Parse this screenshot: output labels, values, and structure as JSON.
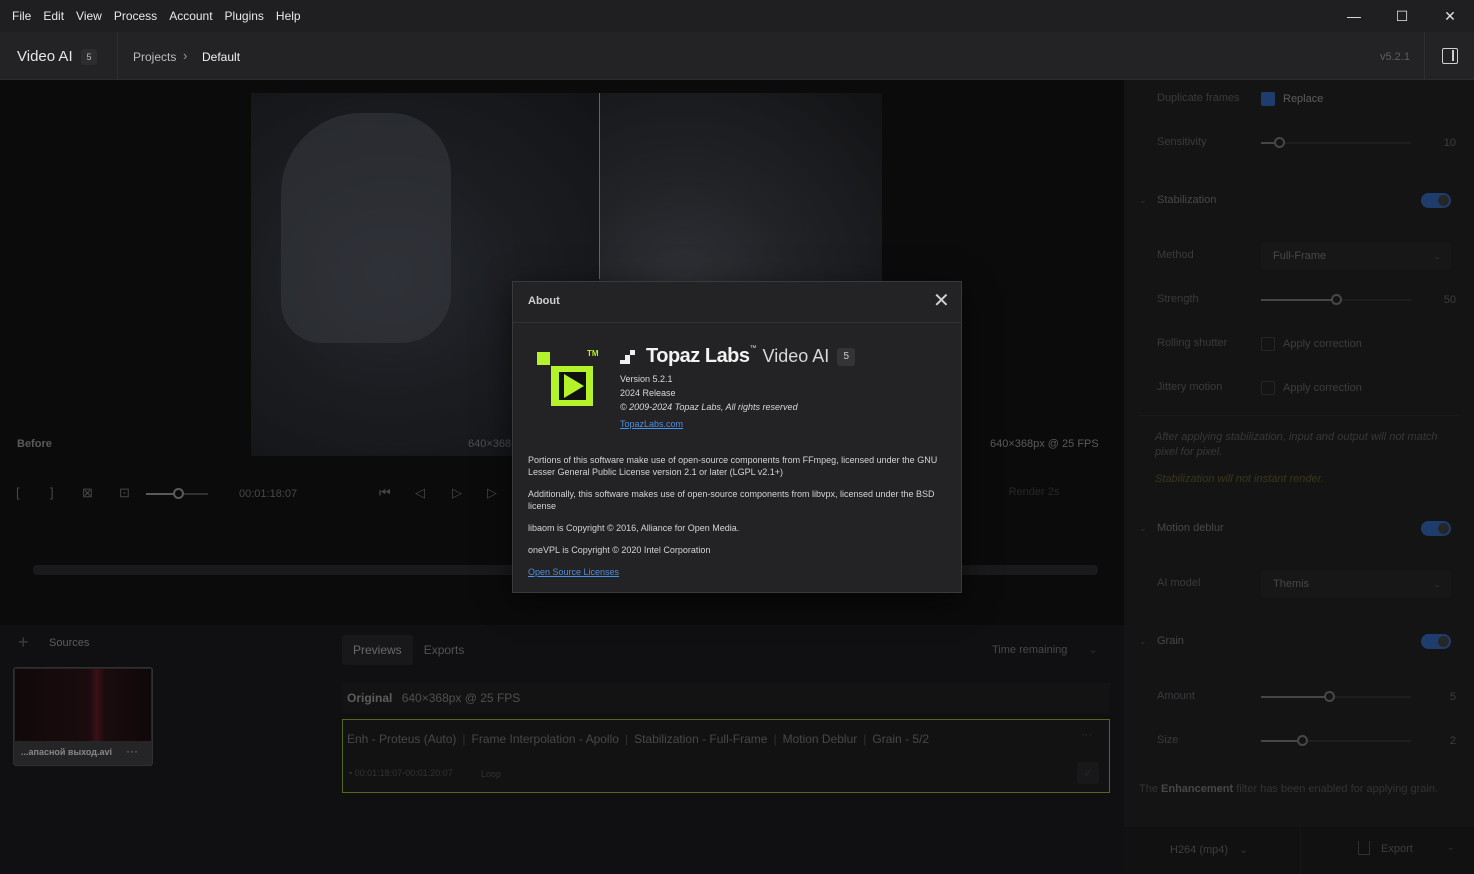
{
  "menu": [
    "File",
    "Edit",
    "View",
    "Process",
    "Account",
    "Plugins",
    "Help"
  ],
  "window_controls": {
    "minimize": "—",
    "maximize": "☐",
    "close": "✕"
  },
  "header": {
    "app_name": "Video AI",
    "app_badge": "5",
    "breadcrumb": [
      "Projects",
      "Default"
    ],
    "version": "v5.2.1"
  },
  "viewer": {
    "before_label": "Before",
    "resolution_left": "640×368",
    "resolution_right": "640×368px @ 25 FPS",
    "timecode": "00:01:18:07",
    "zoom_level": 0.5,
    "render_button": "Render 2s"
  },
  "sources": {
    "label": "Sources",
    "items": [
      {
        "name": "...апасной выход.avi"
      }
    ]
  },
  "queue": {
    "tabs": [
      "Previews",
      "Exports"
    ],
    "active_tab": "Previews",
    "sort_label": "Time remaining",
    "original_label": "Original",
    "original_spec": "640×368px @ 25 FPS",
    "job": {
      "filters": [
        "Enh - Proteus (Auto)",
        "Frame Interpolation - Apollo",
        "Stabilization - Full-Frame",
        "Motion Deblur",
        "Grain - 5/2"
      ],
      "range": "00:01:18:07-00:01:20:07",
      "loop_label": "Loop",
      "more": "···"
    }
  },
  "settings": {
    "duplicate_frames_label": "Duplicate frames",
    "duplicate_frames_option": "Replace",
    "duplicate_frames_checked": true,
    "sensitivity_label": "Sensitivity",
    "sensitivity_value": "10",
    "sensitivity_fraction": 0.12,
    "stabilization_title": "Stabilization",
    "stabilization_on": true,
    "method_label": "Method",
    "method_value": "Full-Frame",
    "strength_label": "Strength",
    "strength_value": "50",
    "strength_fraction": 0.5,
    "rolling_shutter_label": "Rolling shutter",
    "rolling_shutter_option": "Apply correction",
    "jittery_motion_label": "Jittery motion",
    "jittery_motion_option": "Apply correction",
    "stab_note": "After applying stabilization, input and output will not match pixel for pixel.",
    "stab_warning": "Stabilization will not instant render.",
    "motion_deblur_title": "Motion deblur",
    "motion_deblur_on": true,
    "ai_model_label": "AI model",
    "ai_model_value": "Themis",
    "grain_title": "Grain",
    "grain_on": true,
    "amount_label": "Amount",
    "amount_value": "5",
    "amount_fraction": 0.45,
    "size_label": "Size",
    "size_value": "2",
    "size_fraction": 0.27,
    "enhancement_note_pre": "The",
    "enhancement_note_bold": "Enhancement",
    "enhancement_note_post": "filter has been enabled for applying grain.",
    "format": "H264 (mp4)",
    "export_label": "Export"
  },
  "about": {
    "title": "About",
    "brand": "Topaz Labs",
    "brand_tm": "™",
    "product": "Video AI",
    "product_badge": "5",
    "logo_tm": "TM",
    "version": "Version 5.2.1",
    "release": "2024 Release",
    "copyright": "© 2009-2024 Topaz Labs, All rights reserved",
    "website": "TopazLabs.com",
    "para1": "Portions of this software make use of open-source components from FFmpeg, licensed under the GNU Lesser General Public License version 2.1 or later (LGPL v2.1+)",
    "para2": "Additionally, this software makes use of open-source components from libvpx, licensed under the BSD license",
    "para3": "libaom is Copyright © 2016, Alliance for Open Media.",
    "para4": "oneVPL is Copyright © 2020 Intel Corporation",
    "oss_link": "Open Source Licenses"
  }
}
